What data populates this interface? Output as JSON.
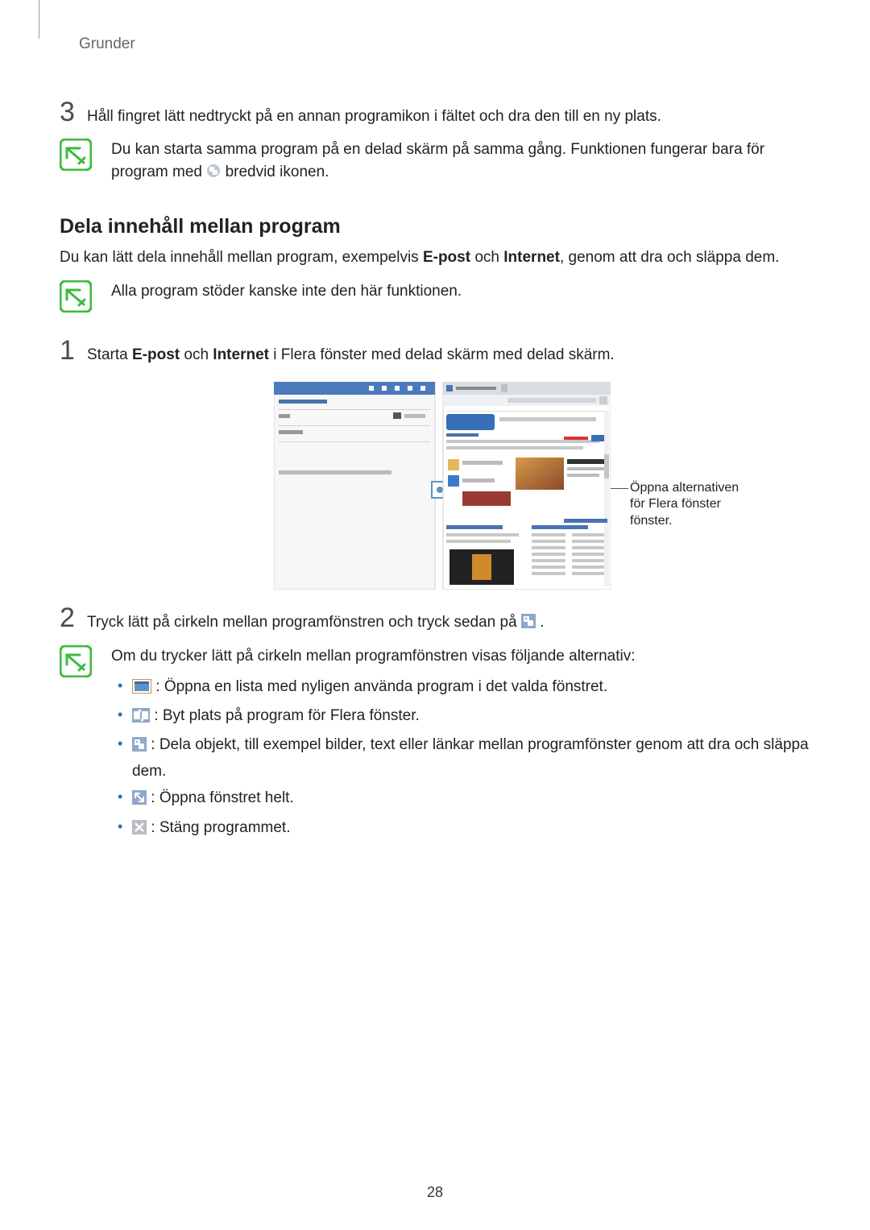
{
  "header": {
    "running_head": "Grunder"
  },
  "step3": {
    "num": "3",
    "text": "Håll fingret lätt nedtryckt på en annan programikon i fältet och dra den till en ny plats."
  },
  "note1": {
    "text_a": "Du kan starta samma program på en delad skärm på samma gång. Funktionen fungerar bara för program med ",
    "text_b": " bredvid ikonen."
  },
  "section": {
    "title": "Dela innehåll mellan program"
  },
  "intro": {
    "text_a": "Du kan lätt dela innehåll mellan program, exempelvis ",
    "bold_a": "E-post",
    "mid": " och ",
    "bold_b": "Internet",
    "text_b": ", genom att dra och släppa dem."
  },
  "note2": {
    "text": "Alla program stöder kanske inte den här funktionen."
  },
  "step1": {
    "num": "1",
    "text_a": "Starta ",
    "bold_a": "E-post",
    "mid": " och ",
    "bold_b": "Internet",
    "text_b": " i Flera fönster med delad skärm med delad skärm."
  },
  "figure": {
    "callout": "Öppna alternativen för Flera fönster fönster."
  },
  "step2": {
    "num": "2",
    "text_a": "Tryck lätt på cirkeln mellan programfönstren och tryck sedan på ",
    "text_b": "."
  },
  "note3": {
    "lead": "Om du trycker lätt på cirkeln mellan programfönstren visas följande alternativ:",
    "items": [
      {
        "text": " : Öppna en lista med nyligen använda program i det valda fönstret."
      },
      {
        "text": " : Byt plats på program för Flera fönster."
      },
      {
        "text": " : Dela objekt, till exempel bilder, text eller länkar mellan programfönster genom att dra och släppa dem."
      },
      {
        "text": " : Öppna fönstret helt."
      },
      {
        "text": " : Stäng programmet."
      }
    ]
  },
  "page_number": "28"
}
